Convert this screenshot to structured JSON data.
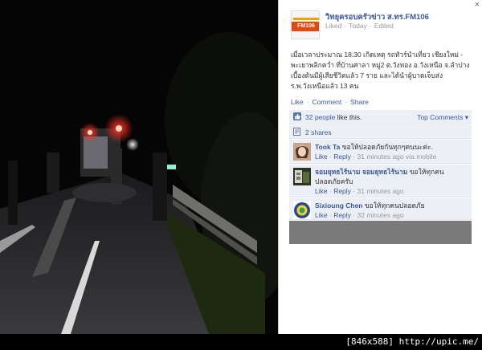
{
  "close_glyph": "×",
  "page": {
    "name": "วิทยุครอบครัวข่าว ส.ทร.FM106",
    "logo_text": "FM106",
    "liked": "Liked",
    "sep": "·",
    "today": "Today",
    "edited": "Edited",
    "post_text": "เมื่อเวลาประมาณ 18:30 เกิดเหตุ รถทัวร์นำเที่ยว เชียงใหม่ - พะเยาพลิกคว่ำ ที่บ้านศาลา หมู่2 ต.วังทอง อ.วังเหนือ จ.ลำปาง เบื้องต้นมีผู้เสียชีวิตแล้ว 7 ราย และได้นำผู้บาดเจ็บส่งร.พ.วังเหนือแล้ว 13 คน"
  },
  "actions": {
    "like": "Like",
    "comment": "Comment",
    "share": "Share"
  },
  "likes": {
    "count_link": "32 people",
    "suffix": " like this.",
    "top_comments": "Top Comments"
  },
  "shares": {
    "label": "2 shares"
  },
  "comments": [
    {
      "author": "Took Ta",
      "text": "ขอให้ปลอดภัยกันทุกๆคนนะค่ะ.",
      "like": "Like",
      "reply": "Reply",
      "time": "31 minutes ago via mobile"
    },
    {
      "author": "จอมยุทธไร้นาม จอมยุทธไร้นาม",
      "text": "ขอให้ทุกคนปลอดภัยครับ",
      "like": "Like",
      "reply": "Reply",
      "time": "31 minutes ago"
    },
    {
      "author": "Sixioung Chen",
      "text": "ขอให้ทุกคนปลอดภัย",
      "like": "Like",
      "reply": "Reply",
      "time": "32 minutes ago"
    }
  ],
  "watermark": "[846x588] http://upic.me/",
  "colors": {
    "link": "#3b5998",
    "panel_row": "#eceff5",
    "comment_input": "#7a7a7a"
  }
}
